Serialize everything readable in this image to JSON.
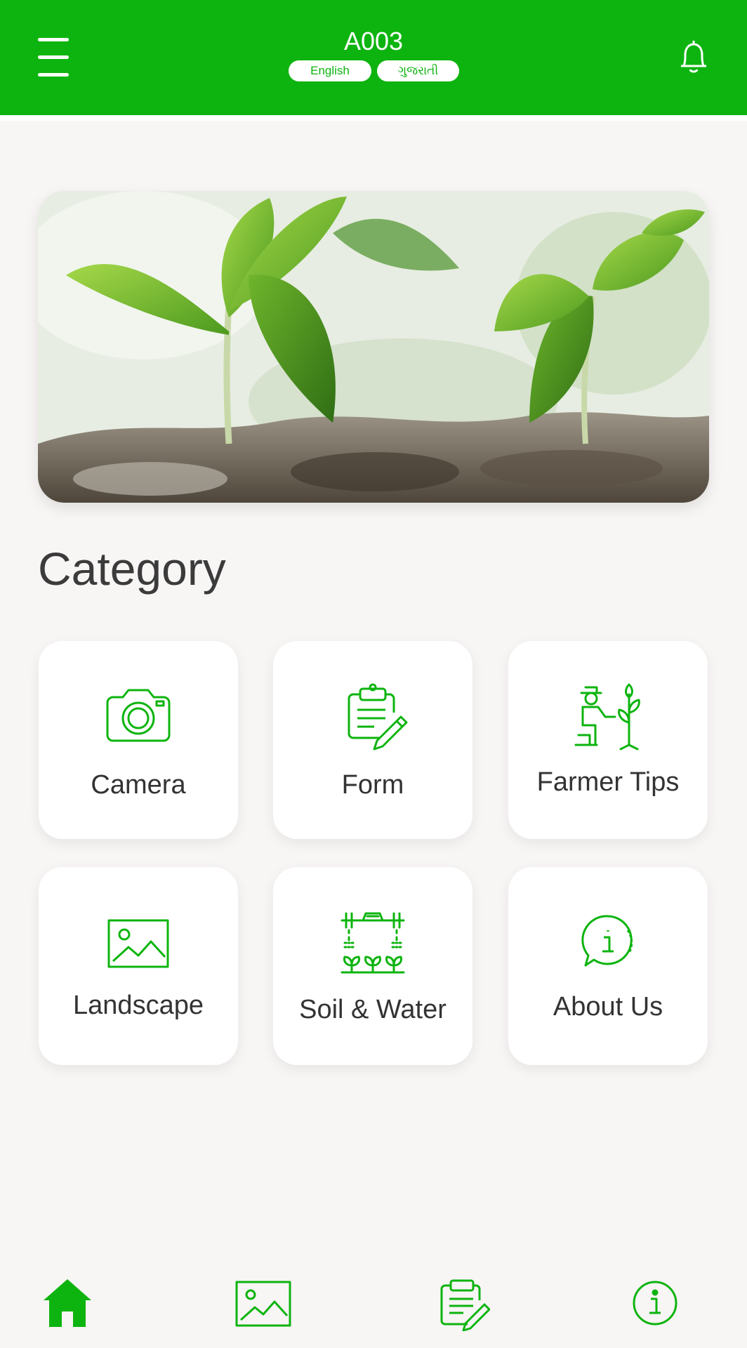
{
  "header": {
    "title": "A003",
    "languages": [
      "English",
      "ગુજરાતી"
    ],
    "menu_icon": "menu-icon",
    "bell_icon": "bell-icon",
    "background_color": "#0db40f"
  },
  "hero": {
    "alt": "seedlings-photo"
  },
  "section": {
    "title": "Category"
  },
  "categories": [
    {
      "label": "Camera",
      "icon": "camera-icon"
    },
    {
      "label": "Form",
      "icon": "clipboard-icon"
    },
    {
      "label": "Farmer Tips",
      "icon": "farmer-icon"
    },
    {
      "label": "Landscape",
      "icon": "image-icon"
    },
    {
      "label": "Soil & Water",
      "icon": "irrigation-icon"
    },
    {
      "label": "About Us",
      "icon": "info-chat-icon"
    }
  ],
  "bottom_nav": [
    {
      "icon": "home-icon",
      "active": true
    },
    {
      "icon": "image-icon",
      "active": false
    },
    {
      "icon": "clipboard-icon",
      "active": false
    },
    {
      "icon": "info-icon",
      "active": false
    }
  ],
  "colors": {
    "accent": "#0db40f",
    "background": "#f8f5f5",
    "text": "#3b3b3b"
  }
}
